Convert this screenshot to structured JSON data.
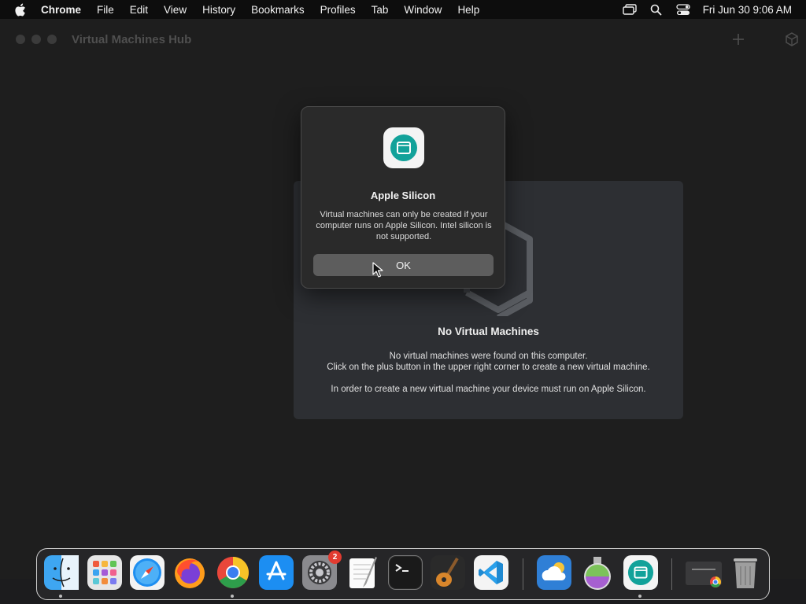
{
  "menubar": {
    "app_name": "Chrome",
    "items": [
      "File",
      "Edit",
      "View",
      "History",
      "Bookmarks",
      "Profiles",
      "Tab",
      "Window",
      "Help"
    ],
    "clock": "Fri Jun 30  9:06 AM"
  },
  "window": {
    "title": "Virtual Machines Hub"
  },
  "empty_state": {
    "title": "No Virtual Machines",
    "line1": "No virtual machines were found on this computer.",
    "line2": "Click on the plus button in the upper right corner to create a new virtual machine.",
    "line3": "In order to create a new virtual machine your device must run on Apple Silicon."
  },
  "alert": {
    "title": "Apple Silicon",
    "message": "Virtual machines can only be created if your computer runs on Apple Silicon. Intel silicon is not supported.",
    "ok_label": "OK"
  },
  "dock": {
    "settings_badge": "2",
    "apps": [
      "finder-icon",
      "launchpad-icon",
      "safari-icon",
      "firefox-icon",
      "chrome-icon",
      "app-store-icon",
      "system-settings-icon",
      "textedit-icon",
      "terminal-icon",
      "garageband-icon",
      "vscode-icon",
      "weather-icon",
      "alchemy-icon",
      "vm-hub-icon",
      "chrome-window-icon",
      "trash-icon"
    ]
  },
  "colors": {
    "accent_teal": "#12a29a",
    "badge_red": "#e23b30"
  }
}
